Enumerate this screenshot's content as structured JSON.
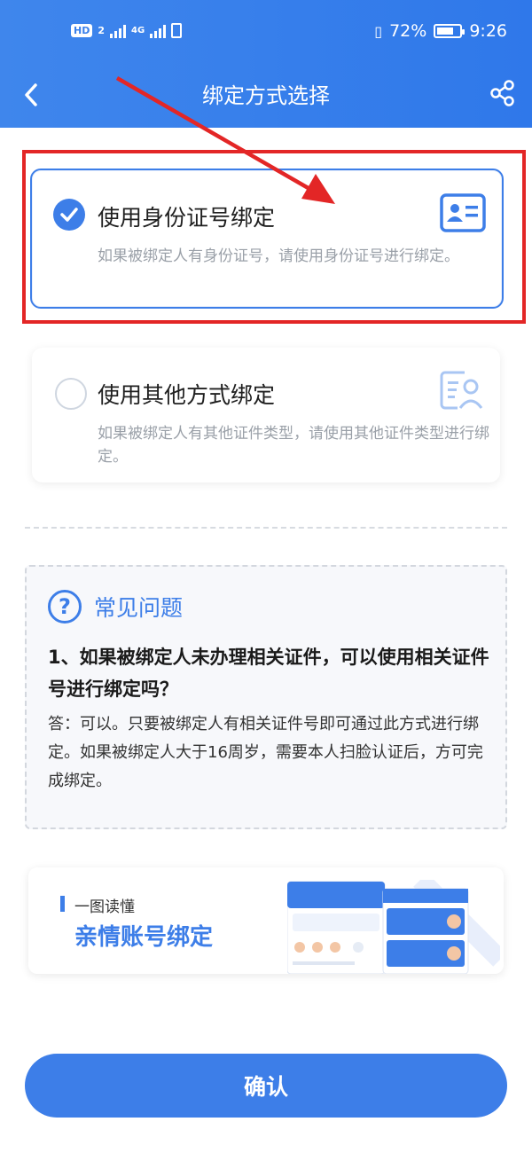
{
  "status": {
    "hd_badge": "HD",
    "hd_sub": "2",
    "network": "4G",
    "battery_percent": "72%",
    "battery_level": 0.72,
    "time": "9:26"
  },
  "nav": {
    "title": "绑定方式选择"
  },
  "options": [
    {
      "title": "使用身份证号绑定",
      "description": "如果被绑定人有身份证号，请使用身份证号进行绑定。",
      "selected": true,
      "icon": "id-card-icon"
    },
    {
      "title": "使用其他方式绑定",
      "description": "如果被绑定人有其他证件类型，请使用其他证件类型进行绑定。",
      "selected": false,
      "icon": "document-person-icon"
    }
  ],
  "faq": {
    "title": "常见问题",
    "question": "1、如果被绑定人未办理相关证件，可以使用相关证件号进行绑定吗？",
    "answer": "答：可以。只要被绑定人有相关证件号即可通过此方式进行绑定。如果被绑定人大于16周岁，需要本人扫脸认证后，方可完成绑定。"
  },
  "banner": {
    "subtitle": "一图读懂",
    "title": "亲情账号绑定"
  },
  "confirm_label": "确认",
  "colors": {
    "primary": "#3d7ee8",
    "highlight": "#e32626"
  }
}
